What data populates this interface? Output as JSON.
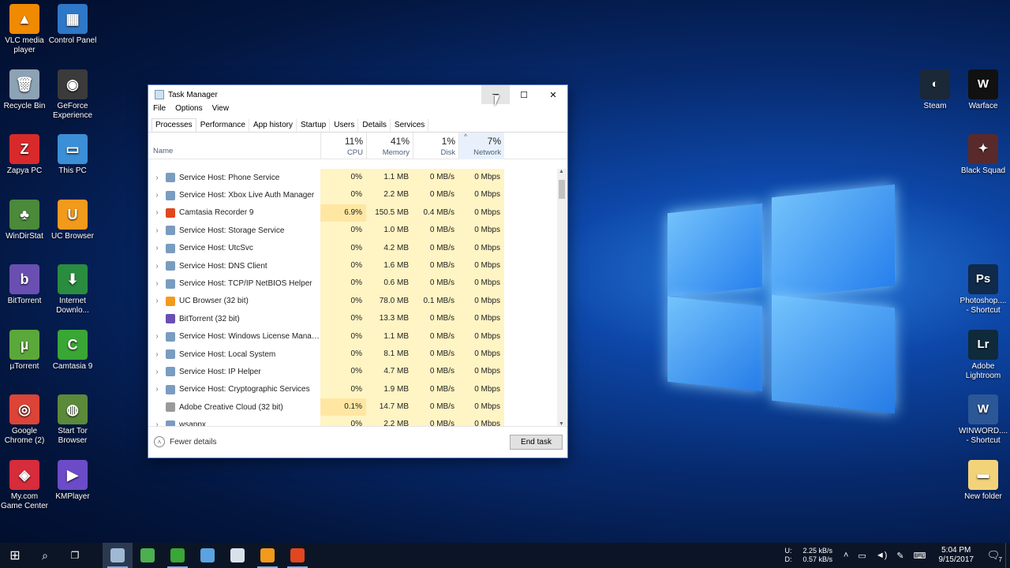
{
  "desktop": {
    "left_icons": [
      {
        "label": "VLC media player",
        "icon": "vlc-icon",
        "color": "#f08a00",
        "glyph": "▲"
      },
      {
        "label": "Control Panel",
        "icon": "control-panel-icon",
        "color": "#2f78c8",
        "glyph": "▦"
      },
      {
        "label": "Recycle Bin",
        "icon": "recycle-bin-icon",
        "color": "#8ca3b5",
        "glyph": "🗑"
      },
      {
        "label": "GeForce Experience",
        "icon": "geforce-icon",
        "color": "#3b3b3b",
        "glyph": "◉"
      },
      {
        "label": "Zapya PC",
        "icon": "zapya-icon",
        "color": "#d82a2a",
        "glyph": "Z"
      },
      {
        "label": "This PC",
        "icon": "this-pc-icon",
        "color": "#3b8fd6",
        "glyph": "▭"
      },
      {
        "label": "WinDirStat",
        "icon": "windirstat-icon",
        "color": "#4a8a3a",
        "glyph": "♣"
      },
      {
        "label": "UC Browser",
        "icon": "uc-browser-icon",
        "color": "#f29a1c",
        "glyph": "U"
      },
      {
        "label": "BitTorrent",
        "icon": "bittorrent-icon",
        "color": "#6a4fb3",
        "glyph": "b"
      },
      {
        "label": "Internet Downlo...",
        "icon": "idm-icon",
        "color": "#2a8c3f",
        "glyph": "⬇"
      },
      {
        "label": "µTorrent",
        "icon": "utorrent-icon",
        "color": "#5ba83a",
        "glyph": "µ"
      },
      {
        "label": "Camtasia 9",
        "icon": "camtasia-icon",
        "color": "#3aa635",
        "glyph": "C"
      },
      {
        "label": "Google Chrome (2)",
        "icon": "chrome-icon",
        "color": "#db4437",
        "glyph": "◎"
      },
      {
        "label": "Start Tor Browser",
        "icon": "tor-icon",
        "color": "#5b8a3a",
        "glyph": "◍"
      },
      {
        "label": "My.com Game Center",
        "icon": "game-center-icon",
        "color": "#d62c3b",
        "glyph": "◈"
      },
      {
        "label": "KMPlayer",
        "icon": "kmplayer-icon",
        "color": "#6b4bc8",
        "glyph": "▶"
      }
    ],
    "right_icons": [
      {
        "label": "Steam",
        "icon": "steam-icon",
        "color": "#1b2838",
        "glyph": "◐"
      },
      {
        "label": "Warface",
        "icon": "warface-icon",
        "color": "#111111",
        "glyph": "W"
      },
      {
        "label": "Black Squad",
        "icon": "black-squad-icon",
        "color": "#5a2a2a",
        "glyph": "✦"
      },
      {
        "label": "Photoshop.... - Shortcut",
        "icon": "photoshop-icon",
        "color": "#0f2a4a",
        "glyph": "Ps"
      },
      {
        "label": "Adobe Lightroom",
        "icon": "lightroom-icon",
        "color": "#0f2a3a",
        "glyph": "Lr"
      },
      {
        "label": "WINWORD.... - Shortcut",
        "icon": "word-icon",
        "color": "#2b5797",
        "glyph": "W"
      },
      {
        "label": "New folder",
        "icon": "folder-icon",
        "color": "#f3d37a",
        "glyph": "▬"
      }
    ]
  },
  "task_manager": {
    "title": "Task Manager",
    "menu": [
      "File",
      "Options",
      "View"
    ],
    "tabs": [
      "Processes",
      "Performance",
      "App history",
      "Startup",
      "Users",
      "Details",
      "Services"
    ],
    "columns": {
      "name": "Name",
      "cpu": {
        "pct": "11%",
        "label": "CPU"
      },
      "memory": {
        "pct": "41%",
        "label": "Memory"
      },
      "disk": {
        "pct": "1%",
        "label": "Disk"
      },
      "network": {
        "pct": "7%",
        "label": "Network"
      }
    },
    "processes": [
      {
        "name": "Service Host: Phone Service",
        "cpu": "0%",
        "mem": "1.1 MB",
        "disk": "0 MB/s",
        "net": "0 Mbps",
        "expandable": true,
        "icon": "gear-icon",
        "icon_color": "#7a9cc0"
      },
      {
        "name": "Service Host: Xbox Live Auth Manager",
        "cpu": "0%",
        "mem": "2.2 MB",
        "disk": "0 MB/s",
        "net": "0 Mbps",
        "expandable": true,
        "icon": "gear-icon",
        "icon_color": "#7a9cc0"
      },
      {
        "name": "Camtasia Recorder 9",
        "cpu": "6.9%",
        "mem": "150.5 MB",
        "disk": "0.4 MB/s",
        "net": "0 Mbps",
        "expandable": true,
        "icon": "camtasia-icon",
        "icon_color": "#e2461e"
      },
      {
        "name": "Service Host: Storage Service",
        "cpu": "0%",
        "mem": "1.0 MB",
        "disk": "0 MB/s",
        "net": "0 Mbps",
        "expandable": true,
        "icon": "gear-icon",
        "icon_color": "#7a9cc0"
      },
      {
        "name": "Service Host: UtcSvc",
        "cpu": "0%",
        "mem": "4.2 MB",
        "disk": "0 MB/s",
        "net": "0 Mbps",
        "expandable": true,
        "icon": "gear-icon",
        "icon_color": "#7a9cc0"
      },
      {
        "name": "Service Host: DNS Client",
        "cpu": "0%",
        "mem": "1.6 MB",
        "disk": "0 MB/s",
        "net": "0 Mbps",
        "expandable": true,
        "icon": "gear-icon",
        "icon_color": "#7a9cc0"
      },
      {
        "name": "Service Host: TCP/IP NetBIOS Helper",
        "cpu": "0%",
        "mem": "0.6 MB",
        "disk": "0 MB/s",
        "net": "0 Mbps",
        "expandable": true,
        "icon": "gear-icon",
        "icon_color": "#7a9cc0"
      },
      {
        "name": "UC Browser (32 bit)",
        "cpu": "0%",
        "mem": "78.0 MB",
        "disk": "0.1 MB/s",
        "net": "0 Mbps",
        "expandable": true,
        "icon": "uc-browser-icon",
        "icon_color": "#f29a1c"
      },
      {
        "name": "BitTorrent (32 bit)",
        "cpu": "0%",
        "mem": "13.3 MB",
        "disk": "0 MB/s",
        "net": "0 Mbps",
        "expandable": false,
        "icon": "bittorrent-icon",
        "icon_color": "#6a4fb3"
      },
      {
        "name": "Service Host: Windows License Manag...",
        "cpu": "0%",
        "mem": "1.1 MB",
        "disk": "0 MB/s",
        "net": "0 Mbps",
        "expandable": true,
        "icon": "gear-icon",
        "icon_color": "#7a9cc0"
      },
      {
        "name": "Service Host: Local System",
        "cpu": "0%",
        "mem": "8.1 MB",
        "disk": "0 MB/s",
        "net": "0 Mbps",
        "expandable": true,
        "icon": "gear-icon",
        "icon_color": "#7a9cc0"
      },
      {
        "name": "Service Host: IP Helper",
        "cpu": "0%",
        "mem": "4.7 MB",
        "disk": "0 MB/s",
        "net": "0 Mbps",
        "expandable": true,
        "icon": "gear-icon",
        "icon_color": "#7a9cc0"
      },
      {
        "name": "Service Host: Cryptographic Services",
        "cpu": "0%",
        "mem": "1.9 MB",
        "disk": "0 MB/s",
        "net": "0 Mbps",
        "expandable": true,
        "icon": "gear-icon",
        "icon_color": "#7a9cc0"
      },
      {
        "name": "Adobe Creative Cloud (32 bit)",
        "cpu": "0.1%",
        "mem": "14.7 MB",
        "disk": "0 MB/s",
        "net": "0 Mbps",
        "expandable": false,
        "icon": "creative-cloud-icon",
        "icon_color": "#9a9a9a"
      },
      {
        "name": "wsappx",
        "cpu": "0%",
        "mem": "2.2 MB",
        "disk": "0 MB/s",
        "net": "0 Mbps",
        "expandable": true,
        "icon": "gear-icon",
        "icon_color": "#7a9cc0"
      }
    ],
    "fewer_details": "Fewer details",
    "end_task": "End task"
  },
  "taskbar": {
    "apps": [
      {
        "icon": "task-manager-icon",
        "color": "#9fb9d4",
        "state": "active"
      },
      {
        "icon": "windirstat-icon",
        "color": "#4caf50",
        "state": "none"
      },
      {
        "icon": "camtasia-icon",
        "color": "#3aa635",
        "state": "running"
      },
      {
        "icon": "control-panel-icon",
        "color": "#5ba3e0",
        "state": "none"
      },
      {
        "icon": "cloud-app-icon",
        "color": "#d9e2ea",
        "state": "none"
      },
      {
        "icon": "uc-browser-icon",
        "color": "#f29a1c",
        "state": "running"
      },
      {
        "icon": "camtasia-recorder-icon",
        "color": "#e2461e",
        "state": "running"
      }
    ],
    "net_up_label": "U:",
    "net_down_label": "D:",
    "net_up": "2.25 kB/s",
    "net_down": "0.57 kB/s",
    "time": "5:04 PM",
    "date": "9/15/2017",
    "notification_count": "7"
  },
  "colors": {
    "cpu_highlight": "#fff4c4",
    "mem_highlight": "#fff4c4",
    "cpu_hot": "#ffe7a2",
    "header_sorted": "#e8f1fb"
  }
}
